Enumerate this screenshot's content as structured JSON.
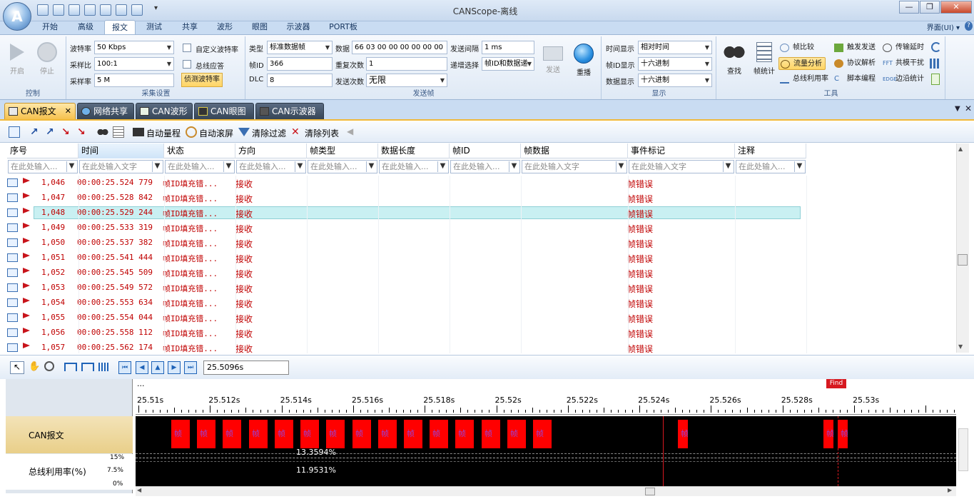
{
  "window": {
    "title": "CANScope-离线",
    "min": "—",
    "max": "❐",
    "close": "✕"
  },
  "menu": {
    "tabs": [
      "开始",
      "高级",
      "报文",
      "测试",
      "共享",
      "波形",
      "眼图",
      "示波器",
      "PORT板"
    ],
    "active": 2,
    "ui_menu": "界面(UI) ▾"
  },
  "ribbon": {
    "control": {
      "start": "开启",
      "stop": "停止",
      "label": "控制"
    },
    "capture": {
      "baud_label": "波特率",
      "baud_value": "50 Kbps",
      "ratio_label": "采样比",
      "ratio_value": "100:1",
      "rate_label": "采样率",
      "rate_value": "5 M",
      "custom_baud": "自定义波特率",
      "bus_ack": "总线应答",
      "detect_baud": "侦测波特率",
      "label": "采集设置"
    },
    "send": {
      "type_label": "类型",
      "type_value": "标准数据帧",
      "id_label": "帧ID",
      "id_value": "366",
      "dlc_label": "DLC",
      "dlc_value": "8",
      "data_label": "数据",
      "data_value": "66 03 00 00 00 00 00 00",
      "repeat_label": "重复次数",
      "repeat_value": "1",
      "count_label": "发送次数",
      "count_value": "无限",
      "interval_label": "发送间隔",
      "interval_value": "1 ms",
      "incr_label": "递增选择",
      "incr_value": "帧ID和数据递",
      "send_btn": "发送",
      "replay_btn": "重播",
      "label": "发送帧"
    },
    "display": {
      "time_label": "时间显示",
      "time_value": "相对时间",
      "id_label": "帧ID显示",
      "id_value": "十六进制",
      "data_label": "数据显示",
      "data_value": "十六进制",
      "label": "显示"
    },
    "tools": {
      "find": "查找",
      "frame_stats": "帧统计",
      "compare": "帧比较",
      "flow": "流量分析",
      "bus_util": "总线利用率",
      "trigger_send": "触发发送",
      "protocol": "协议解析",
      "script": "脚本编程",
      "delay": "传输延时",
      "common_mode": "共模干扰",
      "edge": "边沿统计",
      "label": "工具"
    }
  },
  "doc_tabs": [
    "CAN报文",
    "网络共享",
    "CAN波形",
    "CAN眼图",
    "CAN示波器"
  ],
  "toolbar": {
    "auto_range": "自动量程",
    "auto_scroll": "自动滚屏",
    "clear_filter": "清除过滤",
    "clear_list": "清除列表"
  },
  "grid": {
    "columns": [
      "序号",
      "时间",
      "状态",
      "方向",
      "帧类型",
      "数据长度",
      "帧ID",
      "帧数据",
      "事件标记",
      "注释"
    ],
    "filters": [
      "在此处输入...",
      "在此处输入文字",
      "在此处输入...",
      "在此处输入...",
      "在此处输入...",
      "在此处输入...",
      "在此处输入...",
      "在此处输入文字",
      "在此处输入文字",
      "在此处输入..."
    ],
    "rows": [
      {
        "seq": "1,046",
        "time": "00:00:25.524 779",
        "status": "帧ID填充错...",
        "dir": "接收",
        "event": "帧错误"
      },
      {
        "seq": "1,047",
        "time": "00:00:25.528 842",
        "status": "帧ID填充错...",
        "dir": "接收",
        "event": "帧错误"
      },
      {
        "seq": "1,048",
        "time": "00:00:25.529 244",
        "status": "帧ID填充错...",
        "dir": "接收",
        "event": "帧错误"
      },
      {
        "seq": "1,049",
        "time": "00:00:25.533 319",
        "status": "帧ID填充错...",
        "dir": "接收",
        "event": "帧错误"
      },
      {
        "seq": "1,050",
        "time": "00:00:25.537 382",
        "status": "帧ID填充错...",
        "dir": "接收",
        "event": "帧错误"
      },
      {
        "seq": "1,051",
        "time": "00:00:25.541 444",
        "status": "帧ID填充错...",
        "dir": "接收",
        "event": "帧错误"
      },
      {
        "seq": "1,052",
        "time": "00:00:25.545 509",
        "status": "帧ID填充错...",
        "dir": "接收",
        "event": "帧错误"
      },
      {
        "seq": "1,053",
        "time": "00:00:25.549 572",
        "status": "帧ID填充错...",
        "dir": "接收",
        "event": "帧错误"
      },
      {
        "seq": "1,054",
        "time": "00:00:25.553 634",
        "status": "帧ID填充错...",
        "dir": "接收",
        "event": "帧错误"
      },
      {
        "seq": "1,055",
        "time": "00:00:25.554 044",
        "status": "帧ID填充错...",
        "dir": "接收",
        "event": "帧错误"
      },
      {
        "seq": "1,056",
        "time": "00:00:25.558 112",
        "status": "帧ID填充错...",
        "dir": "接收",
        "event": "帧错误"
      },
      {
        "seq": "1,057",
        "time": "00:00:25.562 174",
        "status": "帧ID填充错...",
        "dir": "接收",
        "event": "帧错误"
      }
    ],
    "selected_row": 2
  },
  "wave": {
    "time_value": "25.5096s",
    "ellipsis": "...",
    "find_marker": "Find",
    "ruler_labels": [
      "25.51s",
      "25.512s",
      "25.514s",
      "25.516s",
      "25.518s",
      "25.52s",
      "25.522s",
      "25.524s",
      "25.526s",
      "25.528s",
      "25.53s"
    ],
    "channels": {
      "can": "CAN报文",
      "bus": "总线利用率(%)"
    },
    "y_ticks": [
      "15%",
      "7.5%",
      "0%"
    ],
    "util_peak": "13.3594%",
    "util_value": "11.9531%",
    "frame_label": "帧I..."
  }
}
